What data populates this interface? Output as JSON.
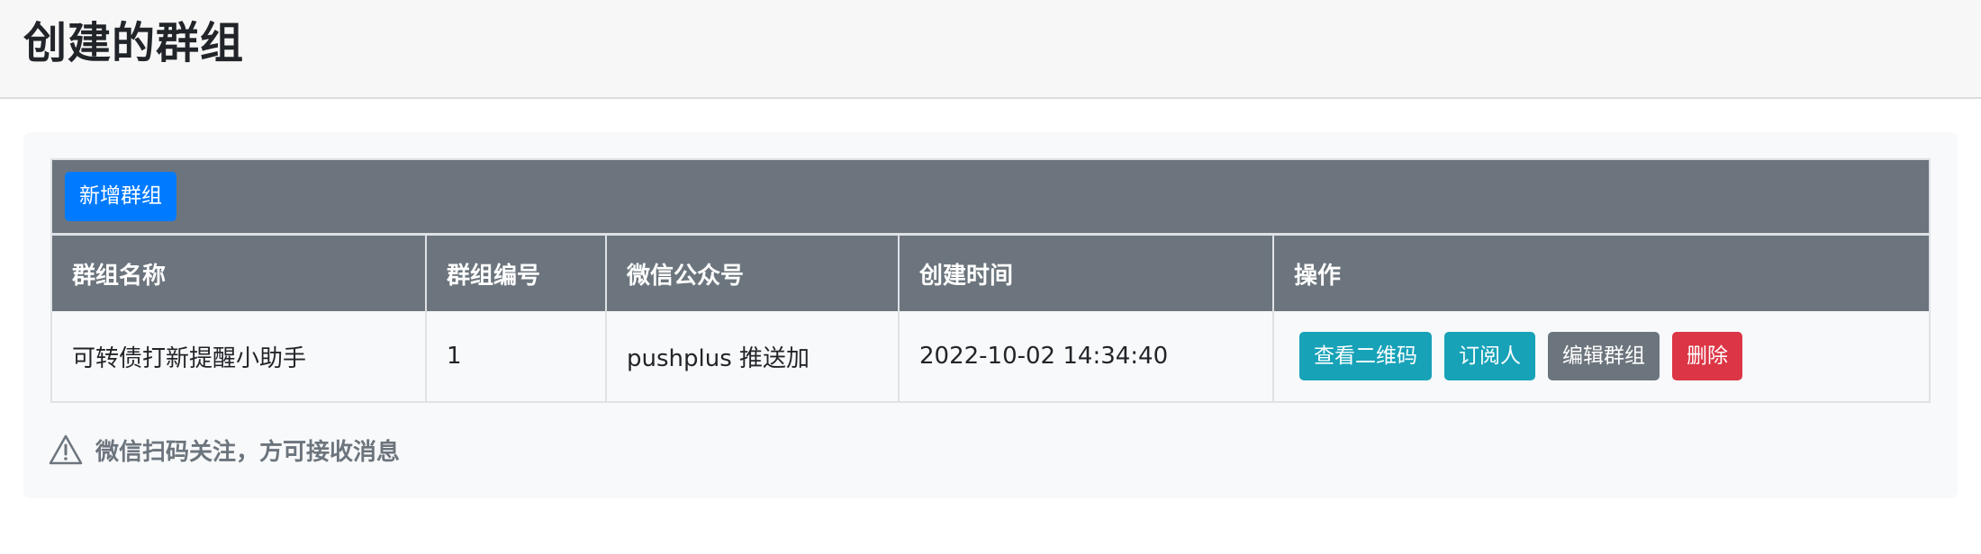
{
  "page": {
    "title": "创建的群组"
  },
  "toolbar": {
    "add_group_label": "新增群组"
  },
  "table": {
    "columns": [
      "群组名称",
      "群组编号",
      "微信公众号",
      "创建时间",
      "操作"
    ],
    "rows": [
      {
        "name": "可转债打新提醒小助手",
        "id": "1",
        "account": "pushplus 推送加",
        "created": "2022-10-02 14:34:40",
        "actions": {
          "qrcode": "查看二维码",
          "subscribers": "订阅人",
          "edit": "编辑群组",
          "delete": "删除"
        }
      }
    ]
  },
  "notice": {
    "icon": "warning-triangle-icon",
    "text": "微信扫码关注，方可接收消息"
  },
  "colors": {
    "primary": "#007bff",
    "info": "#17a2b8",
    "secondary": "#6c757d",
    "danger": "#dc3545"
  }
}
